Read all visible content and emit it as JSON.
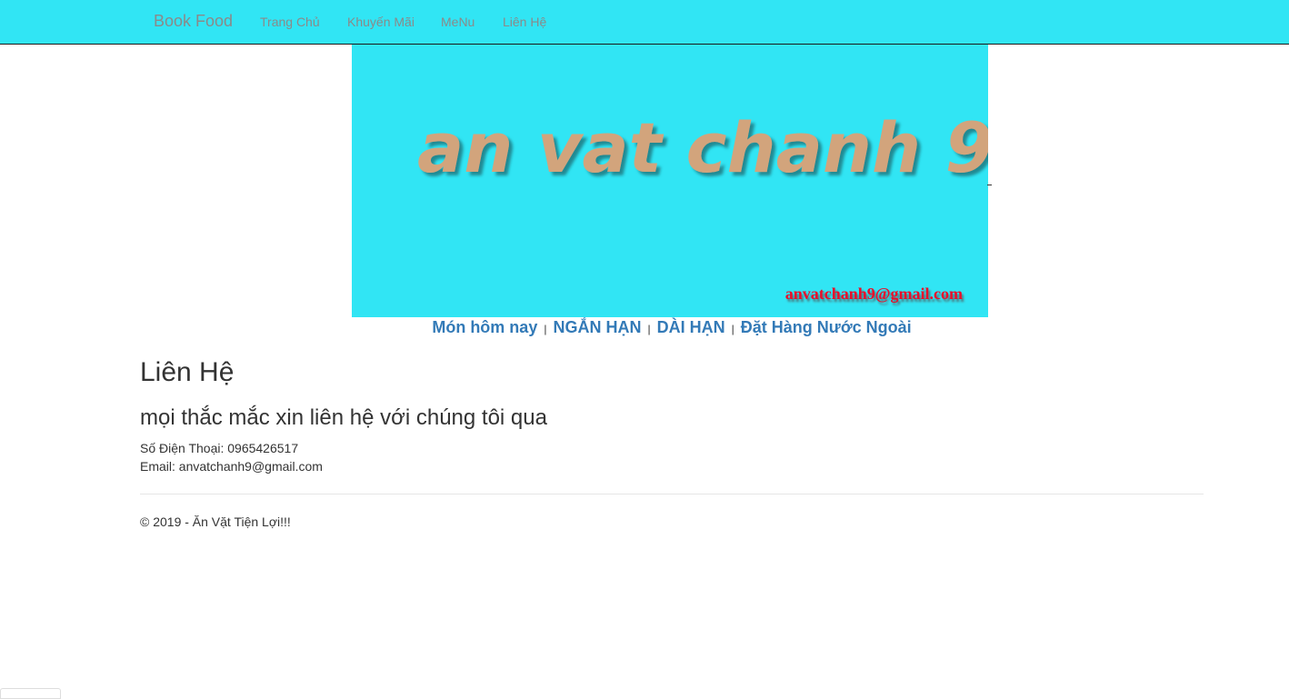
{
  "navbar": {
    "brand": "Book Food",
    "links": [
      "Trang Chủ",
      "Khuyến Mãi",
      "MeNu",
      "Liên Hệ"
    ],
    "bg_color": "#31e5f4"
  },
  "banner": {
    "logo_text": "an vat chanh 9",
    "email_text": "anvatchanh9@gmail.com",
    "bg_color": "#31e5f4",
    "logo_color": "#d2a47c",
    "email_color": "#e8102a"
  },
  "sub_nav": {
    "items": [
      "Món hôm nay",
      "NGẮN HẠN",
      "DÀI HẠN",
      "Đặt Hàng Nước Ngoài"
    ],
    "separator": "|",
    "link_color": "#337ab7"
  },
  "main": {
    "title": "Liên Hệ",
    "subtitle": "mọi thắc mắc xin liên hệ với chúng tôi qua",
    "phone_line": "Số Điện Thoại: 0965426517",
    "email_line": "Email: anvatchanh9@gmail.com"
  },
  "footer": {
    "text": "© 2019 - Ăn Vặt Tiện Lợi!!!"
  }
}
